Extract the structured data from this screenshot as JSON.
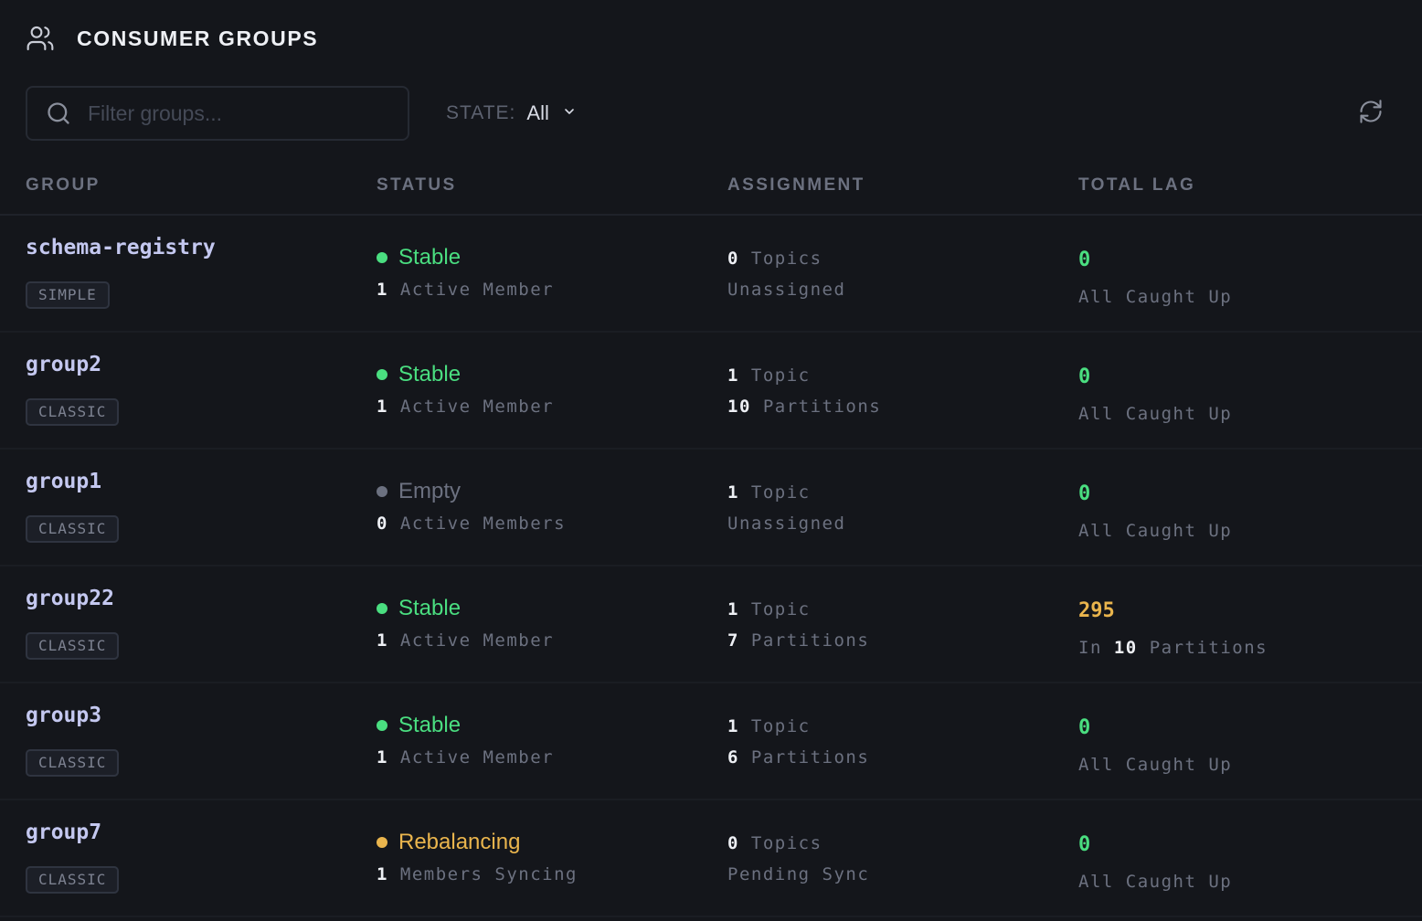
{
  "header": {
    "title": "CONSUMER GROUPS",
    "icon": "users-icon"
  },
  "search": {
    "placeholder": "Filter groups...",
    "value": ""
  },
  "state_filter": {
    "label": "STATE:",
    "value": "All"
  },
  "columns": [
    "GROUP",
    "STATUS",
    "ASSIGNMENT",
    "TOTAL LAG"
  ],
  "colors": {
    "stable": "#4ade80",
    "empty": "#6c7180",
    "rebalancing": "#eab54d",
    "lag_zero": "#4ade80",
    "lag_nonzero": "#eab54d"
  },
  "groups": [
    {
      "name": "schema-registry",
      "type": "SIMPLE",
      "status": "Stable",
      "status_kind": "stable",
      "members_count": "1",
      "members_label": "Active Member",
      "assign_count": "0",
      "assign_label": "Topics",
      "assign_detail_count": "",
      "assign_detail": "Unassigned",
      "lag": "0",
      "lag_kind": "zero",
      "lag_prefix": "",
      "lag_count": "",
      "lag_suffix": "All Caught Up"
    },
    {
      "name": "group2",
      "type": "CLASSIC",
      "status": "Stable",
      "status_kind": "stable",
      "members_count": "1",
      "members_label": "Active Member",
      "assign_count": "1",
      "assign_label": "Topic",
      "assign_detail_count": "10",
      "assign_detail": "Partitions",
      "lag": "0",
      "lag_kind": "zero",
      "lag_prefix": "",
      "lag_count": "",
      "lag_suffix": "All Caught Up"
    },
    {
      "name": "group1",
      "type": "CLASSIC",
      "status": "Empty",
      "status_kind": "empty",
      "members_count": "0",
      "members_label": "Active Members",
      "assign_count": "1",
      "assign_label": "Topic",
      "assign_detail_count": "",
      "assign_detail": "Unassigned",
      "lag": "0",
      "lag_kind": "zero",
      "lag_prefix": "",
      "lag_count": "",
      "lag_suffix": "All Caught Up"
    },
    {
      "name": "group22",
      "type": "CLASSIC",
      "status": "Stable",
      "status_kind": "stable",
      "members_count": "1",
      "members_label": "Active Member",
      "assign_count": "1",
      "assign_label": "Topic",
      "assign_detail_count": "7",
      "assign_detail": "Partitions",
      "lag": "295",
      "lag_kind": "nonzero",
      "lag_prefix": "In",
      "lag_count": "10",
      "lag_suffix": "Partitions"
    },
    {
      "name": "group3",
      "type": "CLASSIC",
      "status": "Stable",
      "status_kind": "stable",
      "members_count": "1",
      "members_label": "Active Member",
      "assign_count": "1",
      "assign_label": "Topic",
      "assign_detail_count": "6",
      "assign_detail": "Partitions",
      "lag": "0",
      "lag_kind": "zero",
      "lag_prefix": "",
      "lag_count": "",
      "lag_suffix": "All Caught Up"
    },
    {
      "name": "group7",
      "type": "CLASSIC",
      "status": "Rebalancing",
      "status_kind": "rebalancing",
      "members_count": "1",
      "members_label": "Members Syncing",
      "assign_count": "0",
      "assign_label": "Topics",
      "assign_detail_count": "",
      "assign_detail": "Pending Sync",
      "lag": "0",
      "lag_kind": "zero",
      "lag_prefix": "",
      "lag_count": "",
      "lag_suffix": "All Caught Up"
    }
  ]
}
